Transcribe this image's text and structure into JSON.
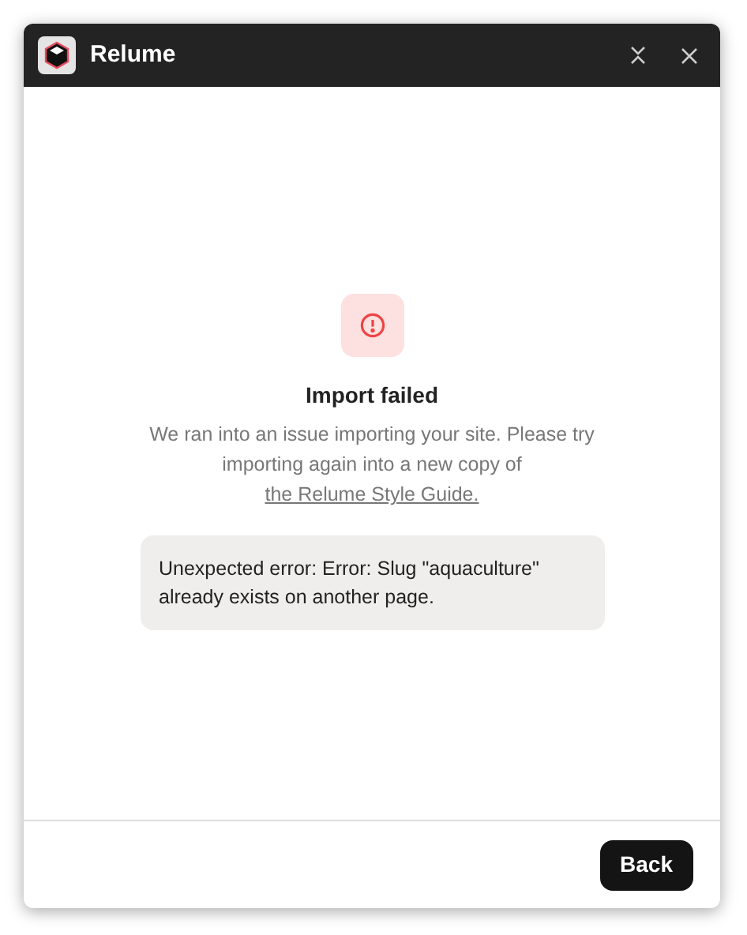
{
  "window": {
    "title": "Relume"
  },
  "dialog": {
    "title": "Import failed",
    "message": "We ran into an issue importing your site. Please try importing again into a new copy of",
    "link": "the Relume Style Guide.",
    "error": "Unexpected error: Error: Slug \"aquaculture\" already exists on another page."
  },
  "buttons": [
    "Back"
  ]
}
